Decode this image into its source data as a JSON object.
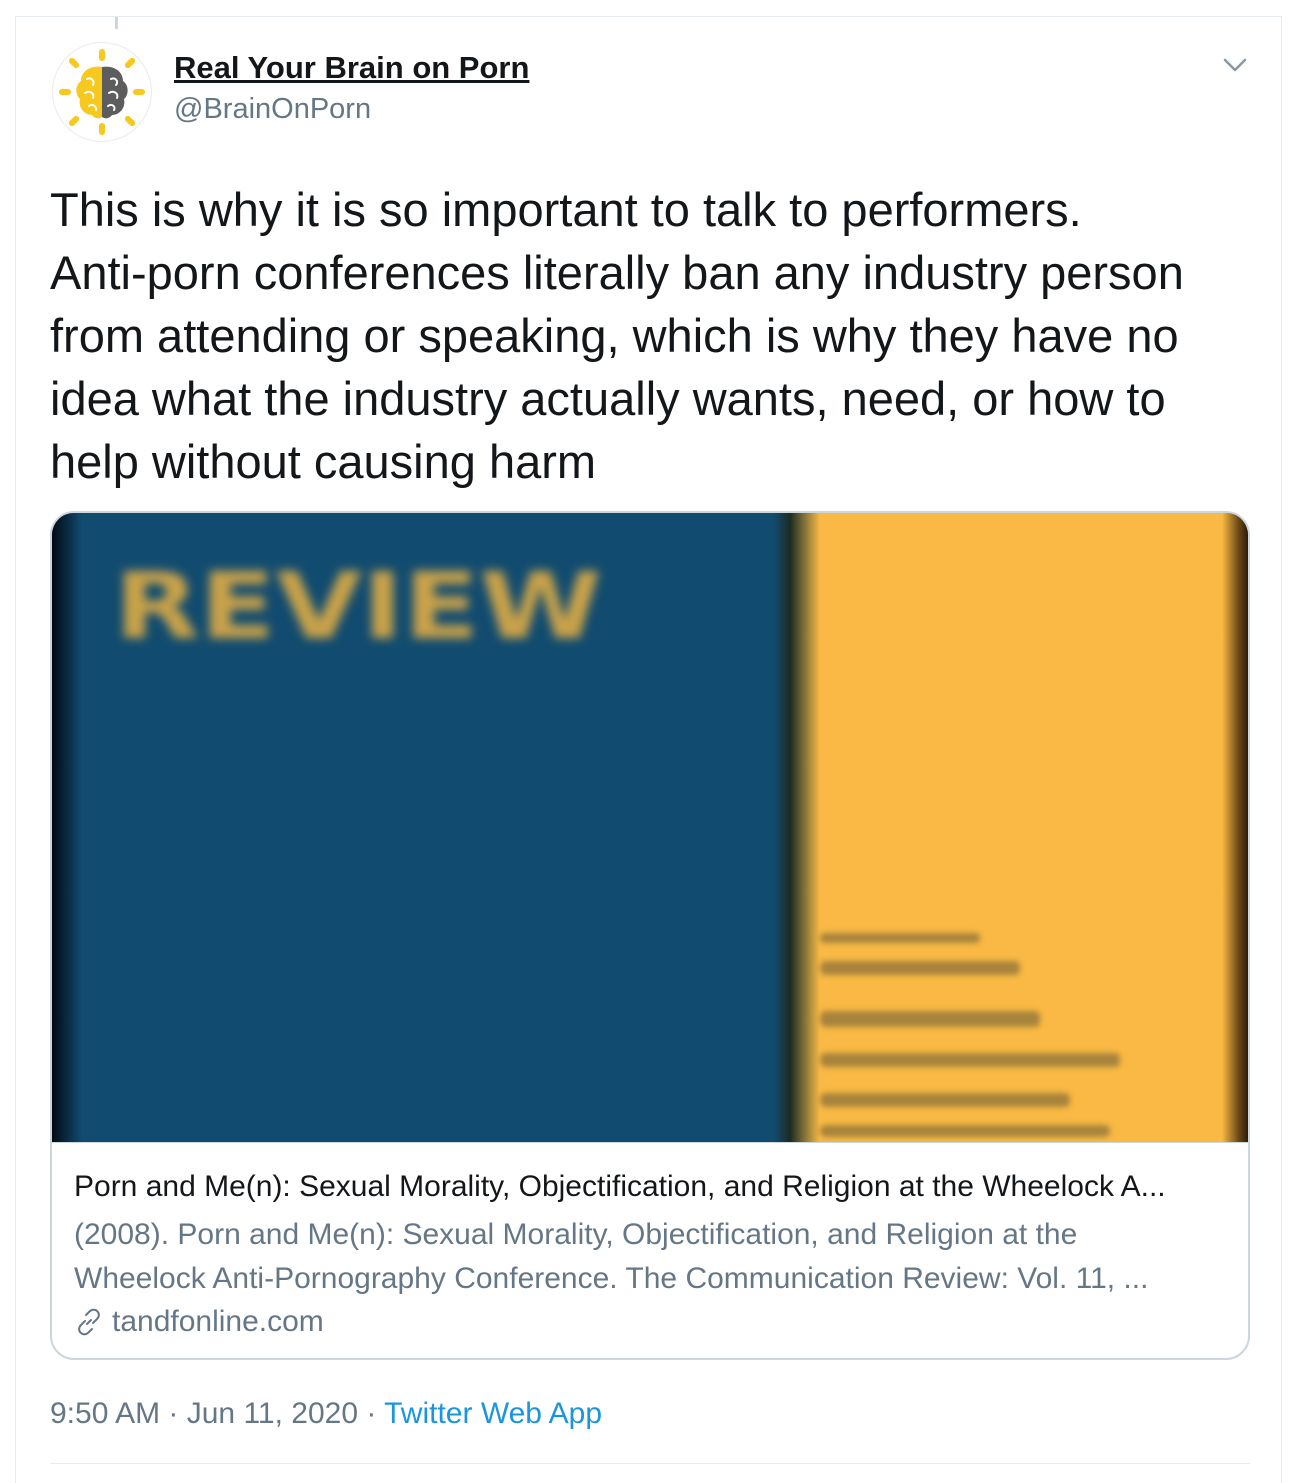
{
  "author": {
    "display_name": "Real Your Brain on Porn",
    "handle": "@BrainOnPorn",
    "avatar_icon": "brain-sun-logo-icon"
  },
  "tweet": {
    "text": "This is why it is so important to talk to performers.\nAnti-porn conferences literally ban any industry person\nfrom attending or speaking, which is why they have no\nidea what the industry actually wants, need, or how to\nhelp without causing harm",
    "more_menu_icon": "chevron-down-icon"
  },
  "card": {
    "image_text": "REVIEW",
    "title": "Porn and Me(n): Sexual Morality, Objectification, and Religion at the Wheelock A...",
    "description_line1": "(2008). Porn and Me(n): Sexual Morality, Objectification, and Religion at the",
    "description_line2": "Wheelock Anti-Pornography Conference. The Communication Review: Vol. 11, ...",
    "domain": "tandfonline.com",
    "link_icon": "link-icon"
  },
  "meta": {
    "time": "9:50 AM",
    "separator": " · ",
    "date": "Jun 11, 2020",
    "source": "Twitter Web App"
  },
  "colors": {
    "primary_text": "#14171a",
    "secondary_text": "#657786",
    "link_blue": "#1b95e0",
    "border": "#ccd6dd",
    "cover_blue": "#114b6f",
    "cover_yellow": "#f9b944",
    "avatar_yellow": "#f7c81e",
    "avatar_gray": "#5d5d5d"
  }
}
